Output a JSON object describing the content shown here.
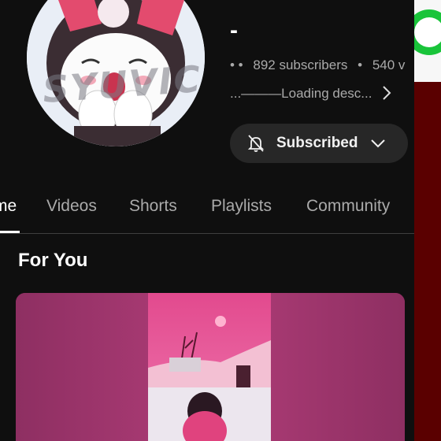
{
  "channel": {
    "name": "-",
    "stats_dots": "•    •",
    "subscribers": "892 subscribers",
    "separator": "•",
    "videos_partial": "540 v",
    "description": "...———Loading desc..."
  },
  "subscribe_button": {
    "label": "Subscribed"
  },
  "tabs": [
    {
      "label": "me",
      "active": true
    },
    {
      "label": "Videos",
      "active": false
    },
    {
      "label": "Shorts",
      "active": false
    },
    {
      "label": "Playlists",
      "active": false
    },
    {
      "label": "Community",
      "active": false
    }
  ],
  "section": {
    "title": "For You"
  },
  "avatar": {
    "watermark": "SYUVIC"
  },
  "colors": {
    "background": "#0f0f0f",
    "button_bg": "#272727",
    "muted_text": "#aaaaaa",
    "accent_strip": "#5a0000",
    "green_badge": "#19c43a"
  }
}
